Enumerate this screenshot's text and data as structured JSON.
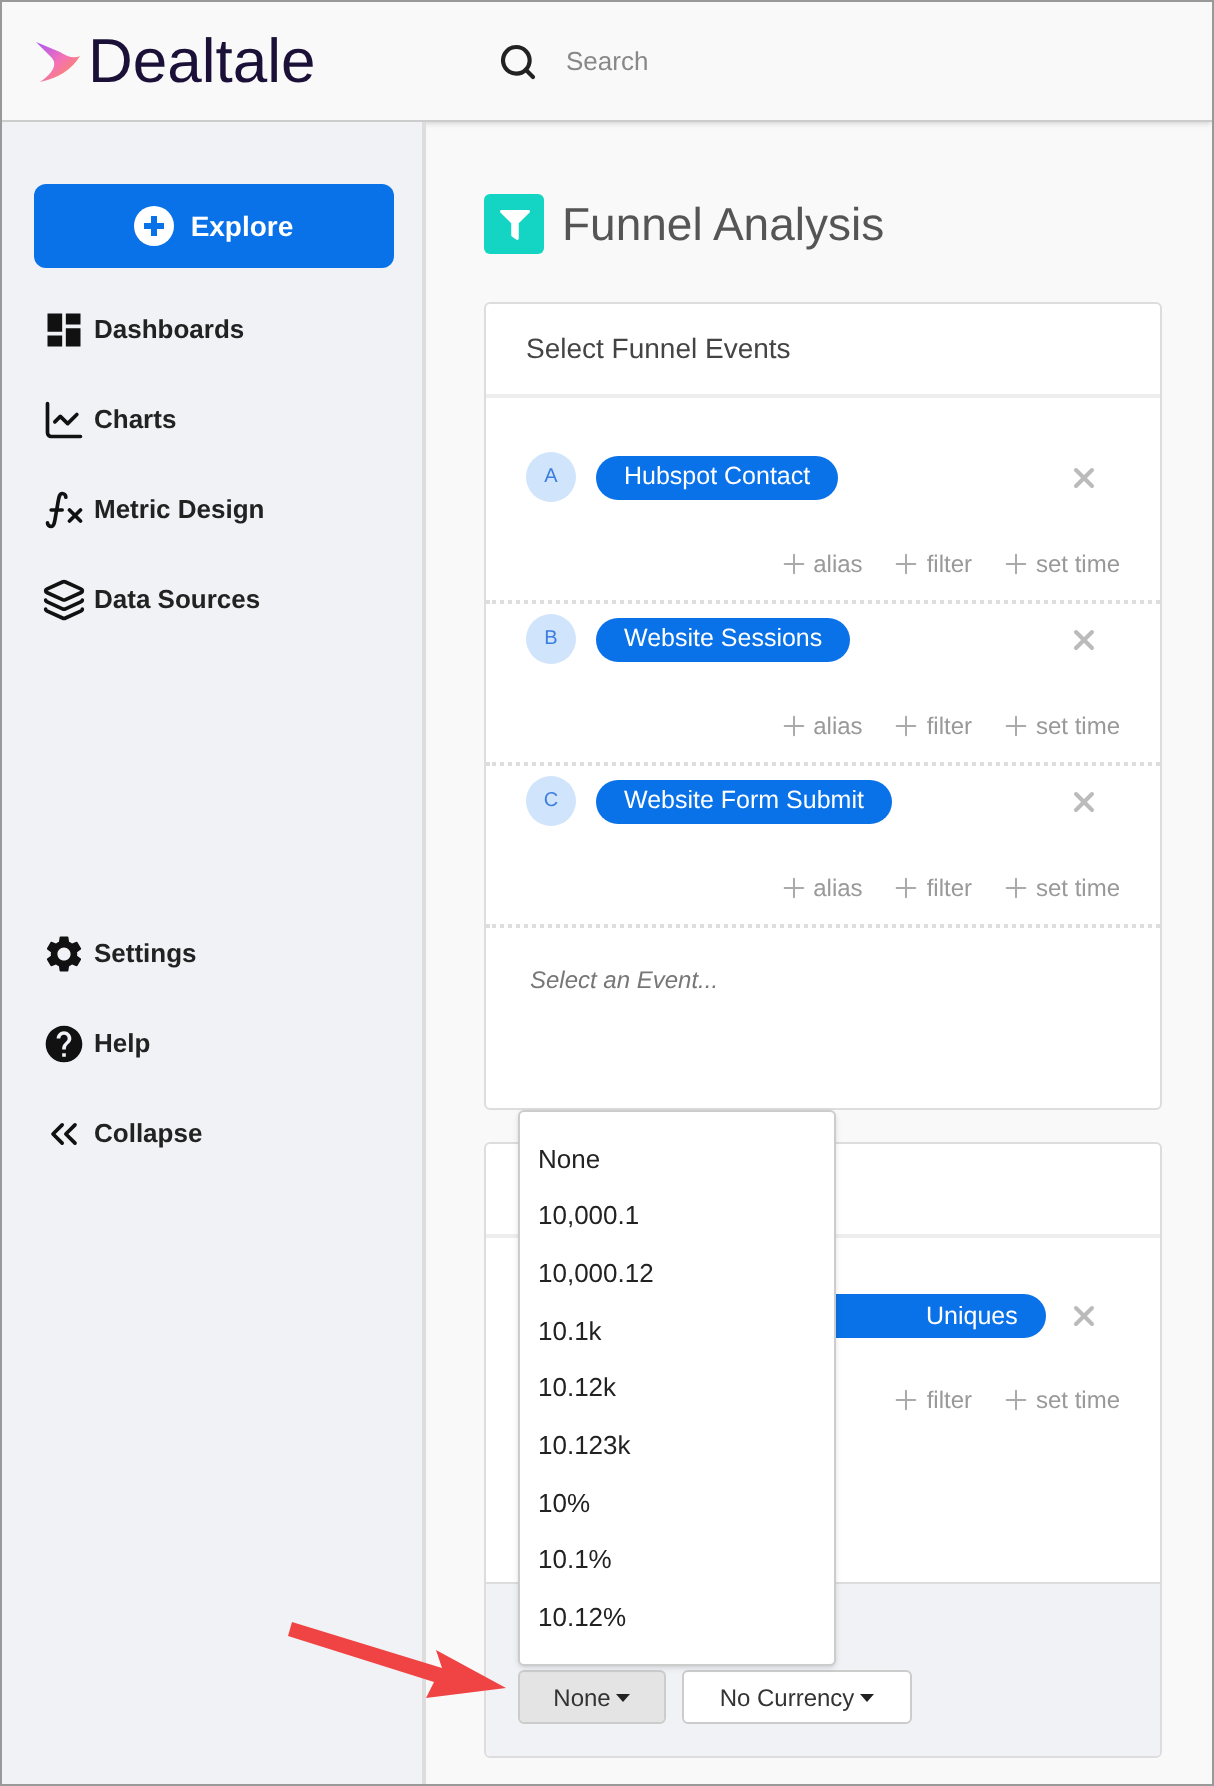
{
  "header": {
    "logo": "Dealtale",
    "search": {
      "placeholder": "Search"
    }
  },
  "sidebar": {
    "primary_button": "Explore",
    "items": [
      {
        "kind": "dashboards",
        "label": "Dashboards"
      },
      {
        "kind": "charts",
        "label": "Charts"
      },
      {
        "kind": "function",
        "label": "Metric Design"
      },
      {
        "kind": "layers",
        "label": "Data Sources"
      }
    ],
    "bottom_items": [
      {
        "kind": "settings",
        "label": "Settings"
      },
      {
        "kind": "help",
        "label": "Help"
      },
      {
        "kind": "collapse",
        "label": "Collapse"
      }
    ]
  },
  "page": {
    "title": "Funnel Analysis"
  },
  "funnel_card": {
    "title": "Select Funnel Events",
    "events": [
      {
        "letter": "A",
        "name": "Hubspot Contact",
        "actions": [
          "alias",
          "filter",
          "set time"
        ]
      },
      {
        "letter": "B",
        "name": "Website Sessions",
        "actions": [
          "alias",
          "filter",
          "set time"
        ]
      },
      {
        "letter": "C",
        "name": "Website Form Submit",
        "actions": [
          "alias",
          "filter",
          "set time"
        ]
      }
    ],
    "event_placeholder": "Select an Event..."
  },
  "second_card": {
    "event": {
      "name": "Uniques",
      "actions": [
        "filter",
        "set time"
      ]
    },
    "format_button": "None",
    "currency_button": "No Currency"
  },
  "format_menu": {
    "options": [
      "None",
      "10,000.1",
      "10,000.12",
      "10.1k",
      "10.12k",
      "10.123k",
      "10%",
      "10.1%",
      "10.12%"
    ]
  }
}
